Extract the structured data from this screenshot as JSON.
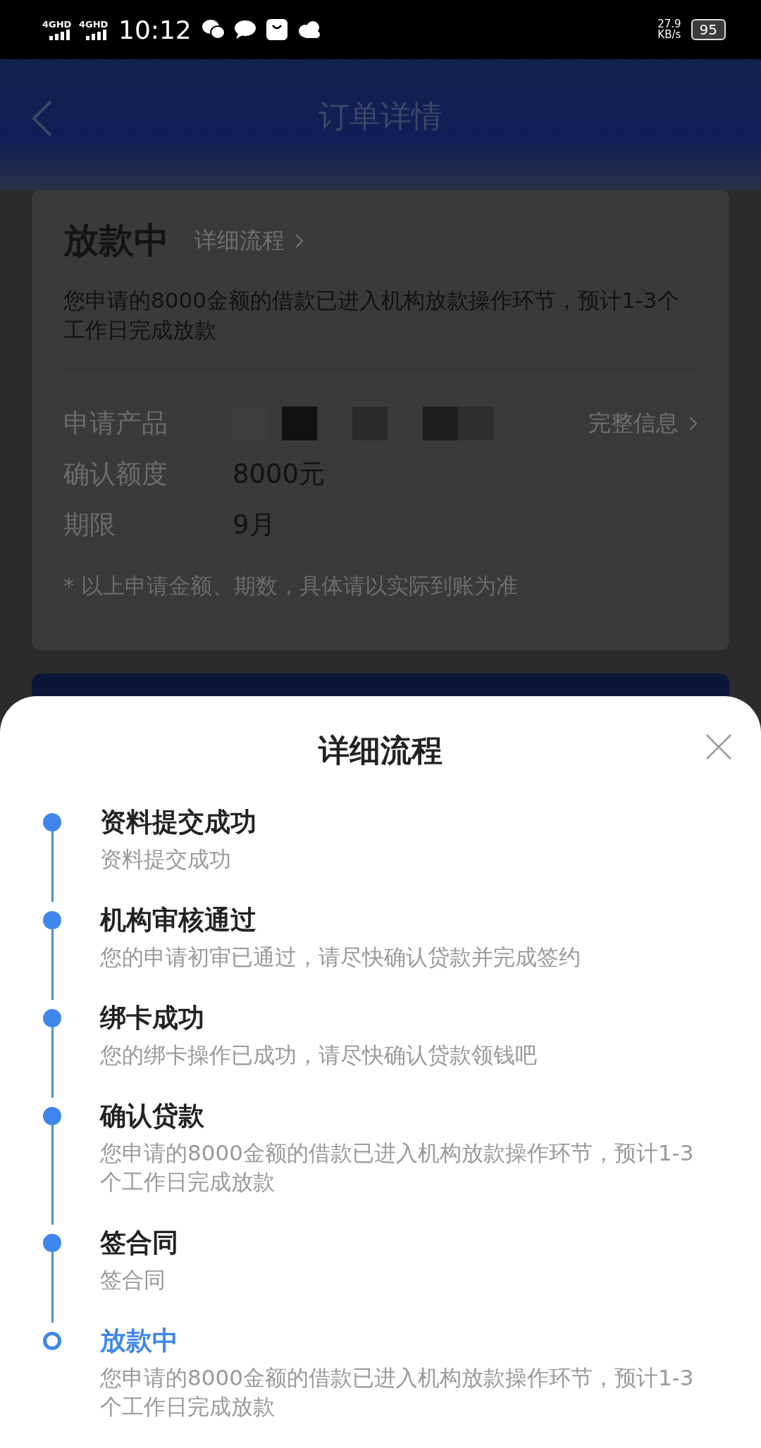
{
  "status_bar": {
    "network_1": "4GHD",
    "network_2": "4GHD",
    "time": "10:12",
    "speed_value": "27.9",
    "speed_unit": "KB/s",
    "battery": "95"
  },
  "header": {
    "title": "订单详情"
  },
  "order_card": {
    "status": "放款中",
    "detail_link": "详细流程",
    "description": "您申请的8000金额的借款已进入机构放款操作环节，预计1-3个工作日完成放款",
    "rows": [
      {
        "label": "申请产品",
        "kind": "redacted",
        "link": "完整信息"
      },
      {
        "label": "确认额度",
        "kind": "text",
        "value": "8000元"
      },
      {
        "label": "期限",
        "kind": "text",
        "value": "9月"
      }
    ],
    "note": "* 以上申请金额、期数，具体请以实际到账为准"
  },
  "sheet": {
    "title": "详细流程",
    "steps": [
      {
        "title": "资料提交成功",
        "detail": "资料提交成功",
        "current": false
      },
      {
        "title": "机构审核通过",
        "detail": "您的申请初审已通过，请尽快确认贷款并完成签约",
        "current": false
      },
      {
        "title": "绑卡成功",
        "detail": "您的绑卡操作已成功，请尽快确认贷款领钱吧",
        "current": false
      },
      {
        "title": "确认贷款",
        "detail": "您申请的8000金额的借款已进入机构放款操作环节，预计1-3个工作日完成放款",
        "current": false
      },
      {
        "title": "签合同",
        "detail": "签合同",
        "current": false
      },
      {
        "title": "放款中",
        "detail": "您申请的8000金额的借款已进入机构放款操作环节，预计1-3个工作日完成放款",
        "current": true
      }
    ]
  }
}
